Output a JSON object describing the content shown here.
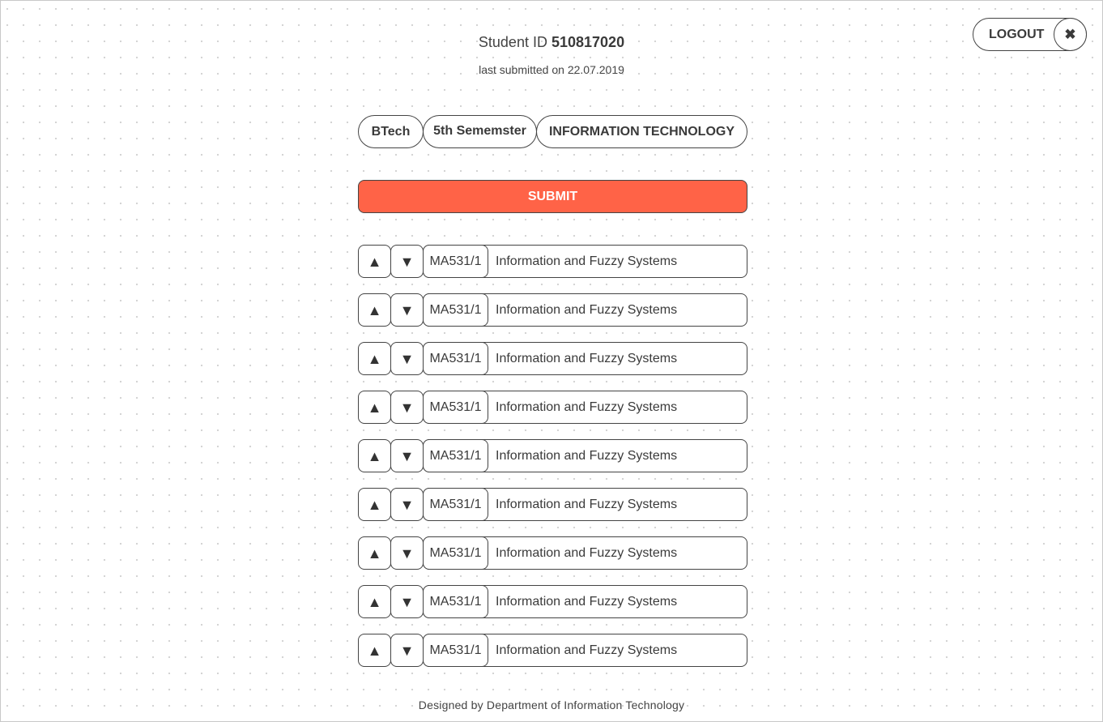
{
  "header": {
    "student_id_label": "Student ID",
    "student_id_value": "510817020",
    "last_submitted_label": "last submitted on",
    "last_submitted_date": "22.07.2019"
  },
  "logout": {
    "label": "LOGOUT",
    "close_glyph": "✖",
    "close_icon": "close-icon"
  },
  "program": {
    "degree": "BTech",
    "semester": "5th Sememster",
    "department": "INFORMATION TECHNOLOGY"
  },
  "submit": {
    "label": "SUBMIT",
    "color": "#ff6347"
  },
  "controls": {
    "up_glyph": "▲",
    "down_glyph": "▼",
    "up_icon": "arrow-up-icon",
    "down_icon": "arrow-down-icon"
  },
  "courses": [
    {
      "code": "MA531/1",
      "name": "Information and Fuzzy Systems"
    },
    {
      "code": "MA531/1",
      "name": "Information and Fuzzy Systems"
    },
    {
      "code": "MA531/1",
      "name": "Information and Fuzzy Systems"
    },
    {
      "code": "MA531/1",
      "name": "Information and Fuzzy Systems"
    },
    {
      "code": "MA531/1",
      "name": "Information and Fuzzy Systems"
    },
    {
      "code": "MA531/1",
      "name": "Information and Fuzzy Systems"
    },
    {
      "code": "MA531/1",
      "name": "Information and Fuzzy Systems"
    },
    {
      "code": "MA531/1",
      "name": "Information and Fuzzy Systems"
    },
    {
      "code": "MA531/1",
      "name": "Information and Fuzzy Systems"
    }
  ],
  "footer": {
    "text": "Designed by Department of Information Technology"
  }
}
